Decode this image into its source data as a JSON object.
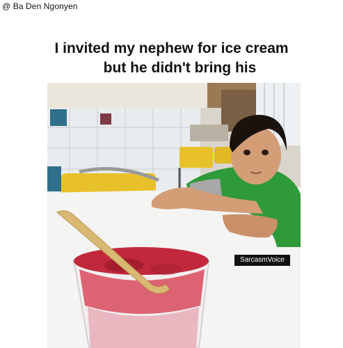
{
  "post": {
    "handle": "@ Ba Den Ngonyen",
    "caption_line1": "I invited my nephew for ice cream",
    "caption_line2": "but he didn't bring his"
  },
  "photo": {
    "subject": "boy-at-table-with-ice-cream-cup-icon",
    "watermark": "SarcasmVoice"
  },
  "colors": {
    "background": "#ffffff",
    "text": "#111111",
    "shirt_green": "#2f9a3a",
    "chair_yellow": "#e8c12a",
    "dessert_red": "#c2283b"
  }
}
